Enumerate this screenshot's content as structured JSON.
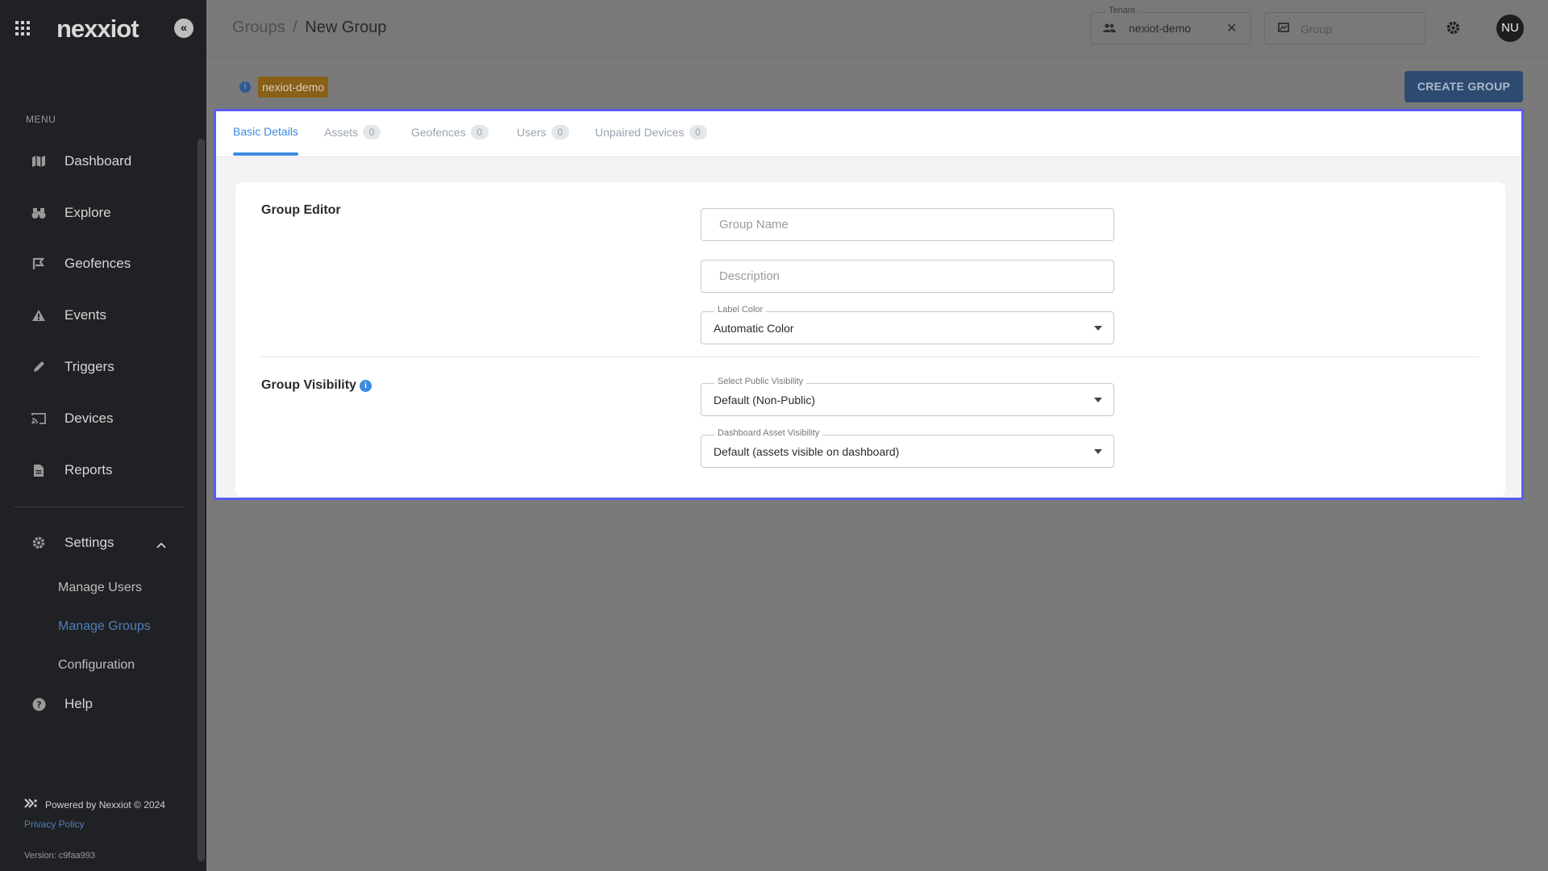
{
  "sidebar": {
    "logo": "nexxiot",
    "menu_label": "MENU",
    "items": [
      {
        "label": "Dashboard",
        "icon": "dashboard-map-icon"
      },
      {
        "label": "Explore",
        "icon": "binoculars-icon"
      },
      {
        "label": "Geofences",
        "icon": "geofence-flag-icon"
      },
      {
        "label": "Events",
        "icon": "warning-triangle-icon"
      },
      {
        "label": "Triggers",
        "icon": "pencil-icon"
      },
      {
        "label": "Devices",
        "icon": "cast-device-icon"
      },
      {
        "label": "Reports",
        "icon": "report-document-icon"
      }
    ],
    "settings": {
      "label": "Settings",
      "sub_items": [
        {
          "label": "Manage Users"
        },
        {
          "label": "Manage Groups",
          "active": true
        },
        {
          "label": "Configuration"
        }
      ]
    },
    "help_label": "Help",
    "footer": {
      "powered": "Powered by Nexxiot © 2024",
      "privacy": "Privacy Policy",
      "version": "Version: c9faa993"
    }
  },
  "header": {
    "breadcrumb_parent": "Groups",
    "breadcrumb_sep": "/",
    "breadcrumb_current": "New Group",
    "tenant_legend": "Tenant",
    "tenant_value": "nexiot-demo",
    "clear_symbol": "✕",
    "group_placeholder": "Group",
    "avatar_initials": "NU"
  },
  "toolbar": {
    "tenant_tag": "nexiot-demo",
    "create_label": "CREATE GROUP"
  },
  "tabs": [
    {
      "label": "Basic Details",
      "active": true
    },
    {
      "label": "Assets",
      "count": "0"
    },
    {
      "label": "Geofences",
      "count": "0"
    },
    {
      "label": "Users",
      "count": "0"
    },
    {
      "label": "Unpaired Devices",
      "count": "0"
    }
  ],
  "form": {
    "editor_title": "Group Editor",
    "group_name_placeholder": "Group Name",
    "description_placeholder": "Description",
    "label_color": {
      "legend": "Label Color",
      "value": "Automatic Color"
    },
    "visibility_title": "Group Visibility",
    "public_visibility": {
      "legend": "Select Public Visibility",
      "value": "Default (Non-Public)"
    },
    "dashboard_visibility": {
      "legend": "Dashboard Asset Visibility",
      "value": "Default (assets visible on dashboard)"
    }
  },
  "colors": {
    "sidebar_bg": "#202124",
    "accent": "#3a8be0",
    "highlight_border": "#5b5bf0",
    "tag_bg": "#8a5f17",
    "primary_button": "#2e4a70"
  }
}
